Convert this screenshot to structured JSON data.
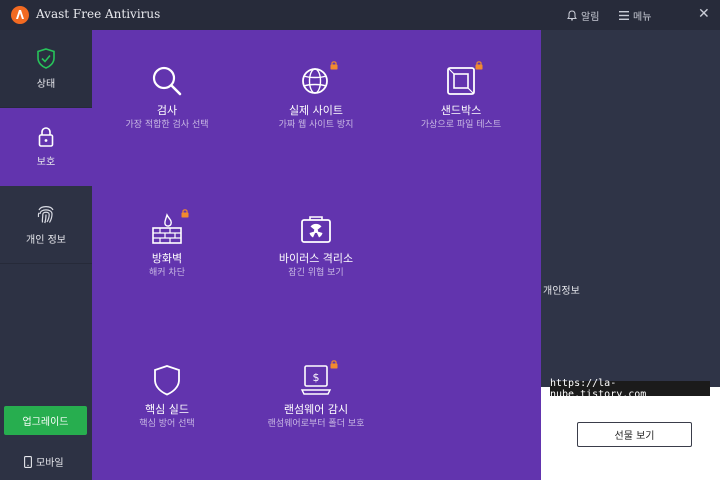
{
  "app": {
    "title": "Avast Free Antivirus",
    "brand_color": "#f26a21"
  },
  "titlebar": {
    "notifications": "알림",
    "menu": "메뉴",
    "close": "✕"
  },
  "sidebar": {
    "items": [
      {
        "label": "상태",
        "icon": "shield-check-icon"
      },
      {
        "label": "보호",
        "icon": "lock-icon",
        "active": true
      },
      {
        "label": "개인 정보",
        "icon": "fingerprint-icon"
      }
    ],
    "upgrade": "업그레이드",
    "mobile": "모바일"
  },
  "protection": {
    "tiles": [
      {
        "title": "검사",
        "subtitle": "가장 적합한 검사 선택",
        "icon": "magnifier-icon",
        "locked": false
      },
      {
        "title": "실제 사이트",
        "subtitle": "가짜 웹 사이트 방지",
        "icon": "globe-icon",
        "locked": true
      },
      {
        "title": "샌드박스",
        "subtitle": "가상으로 파일 테스트",
        "icon": "sandbox-icon",
        "locked": true
      },
      {
        "title": "방화벽",
        "subtitle": "해커 차단",
        "icon": "firewall-icon",
        "locked": true
      },
      {
        "title": "바이러스 격리소",
        "subtitle": "잠긴 위협 보기",
        "icon": "quarantine-icon",
        "locked": false
      },
      {
        "title": "핵심 실드",
        "subtitle": "핵심 방어 선택",
        "icon": "shield-icon",
        "locked": false
      },
      {
        "title": "랜섬웨어 감시",
        "subtitle": "랜섬웨어로부터 폴더 보호",
        "icon": "ransomware-icon",
        "locked": true
      }
    ]
  },
  "right": {
    "label": "개인정보",
    "url": "https://la-nube.tistory.com",
    "gift_button": "선물 보기"
  },
  "colors": {
    "panel": "#6234ae",
    "sidebar": "#2d3244",
    "upgrade": "#27ae4f",
    "lock": "#f28a2e"
  }
}
